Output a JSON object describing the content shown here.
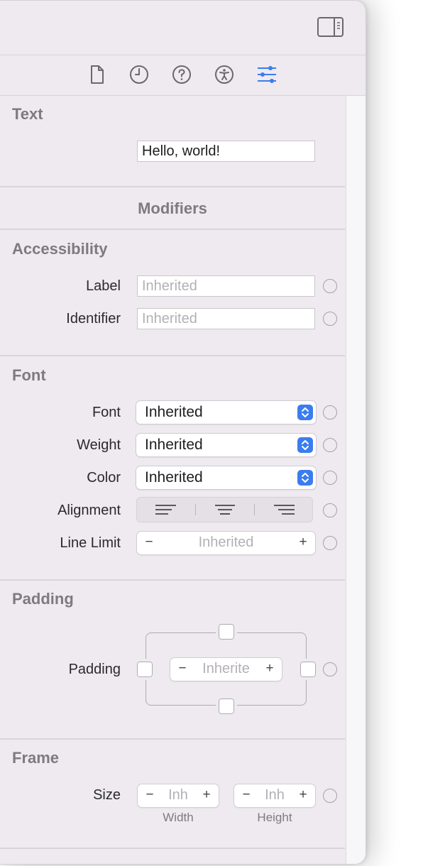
{
  "tabs": [
    {
      "name": "file-inspector",
      "icon": "document-icon"
    },
    {
      "name": "history-inspector",
      "icon": "clock-icon"
    },
    {
      "name": "quick-help",
      "icon": "question-icon"
    },
    {
      "name": "accessibility-inspector",
      "icon": "accessibility-icon"
    },
    {
      "name": "attributes-inspector",
      "icon": "sliders-icon",
      "active": true
    }
  ],
  "text_section": {
    "title": "Text",
    "value": "Hello, world!"
  },
  "modifiers_header": "Modifiers",
  "accessibility": {
    "title": "Accessibility",
    "label_label": "Label",
    "label_placeholder": "Inherited",
    "identifier_label": "Identifier",
    "identifier_placeholder": "Inherited"
  },
  "font": {
    "title": "Font",
    "font_label": "Font",
    "font_value": "Inherited",
    "weight_label": "Weight",
    "weight_value": "Inherited",
    "color_label": "Color",
    "color_value": "Inherited",
    "alignment_label": "Alignment",
    "alignment_options": [
      "leading",
      "center",
      "trailing"
    ],
    "line_limit_label": "Line Limit",
    "line_limit_value": "Inherited",
    "minus": "−",
    "plus": "+"
  },
  "padding": {
    "title": "Padding",
    "label": "Padding",
    "value": "Inherite",
    "minus": "−",
    "plus": "+"
  },
  "frame": {
    "title": "Frame",
    "size_label": "Size",
    "width_value": "Inh",
    "height_value": "Inh",
    "width_caption": "Width",
    "height_caption": "Height",
    "minus": "−",
    "plus": "+"
  },
  "colors": {
    "accent": "#3b7df0",
    "panel": "#efe9f0"
  }
}
